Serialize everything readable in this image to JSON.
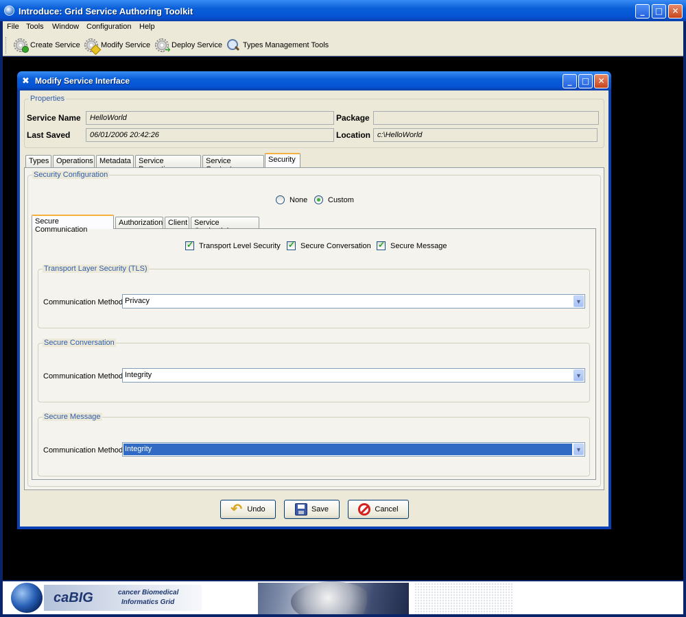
{
  "app": {
    "title": "Introduce: Grid Service Authoring Toolkit",
    "window_controls": {
      "minimize": "_",
      "maximize": "□",
      "close": "✕"
    }
  },
  "menu": [
    "File",
    "Tools",
    "Window",
    "Configuration",
    "Help"
  ],
  "toolbar": {
    "create_service": "Create Service",
    "modify_service": "Modify Service",
    "deploy_service": "Deploy Service",
    "types_management": "Types Management Tools"
  },
  "dialog": {
    "title": "Modify Service Interface",
    "properties": {
      "legend": "Properties",
      "service_name_label": "Service Name",
      "service_name_value": "HelloWorld",
      "package_label": "Package",
      "package_value": "",
      "last_saved_label": "Last Saved",
      "last_saved_value": "06/01/2006 20:42:26",
      "location_label": "Location",
      "location_value": "c:\\HelloWorld"
    },
    "tabs": [
      "Types",
      "Operations",
      "Metadata",
      "Service Properties",
      "Service Contexts",
      "Security"
    ],
    "active_tab": "Security",
    "security": {
      "legend": "Security Configuration",
      "none_label": "None",
      "custom_label": "Custom",
      "selected_mode": "Custom",
      "subtabs": [
        "Secure Communication",
        "Authorization",
        "Client",
        "Service Credentials"
      ],
      "active_subtab": "Secure Communication",
      "checks": {
        "transport": {
          "label": "Transport Level Security",
          "checked": true
        },
        "conversation": {
          "label": "Secure Conversation",
          "checked": true
        },
        "message": {
          "label": "Secure Message",
          "checked": true
        }
      },
      "tls": {
        "legend": "Transport Layer Security (TLS)",
        "method_label": "Communication Method",
        "method_value": "Privacy"
      },
      "conversation": {
        "legend": "Secure Conversation",
        "method_label": "Communication Method",
        "method_value": "Integrity"
      },
      "message": {
        "legend": "Secure Message",
        "method_label": "Communication Method",
        "method_value": "Integrity"
      }
    },
    "buttons": {
      "undo": "Undo",
      "save": "Save",
      "cancel": "Cancel"
    }
  },
  "banner": {
    "brand": "caBIG",
    "tagline_1": "cancer Biomedical",
    "tagline_2": "Informatics Grid"
  },
  "colors": {
    "titlebar": "#0553d4",
    "window_bg": "#ece9d8",
    "legend_text": "#2f5caa",
    "selection": "#316ac5",
    "active_tab_accent": "#f3b03f"
  }
}
